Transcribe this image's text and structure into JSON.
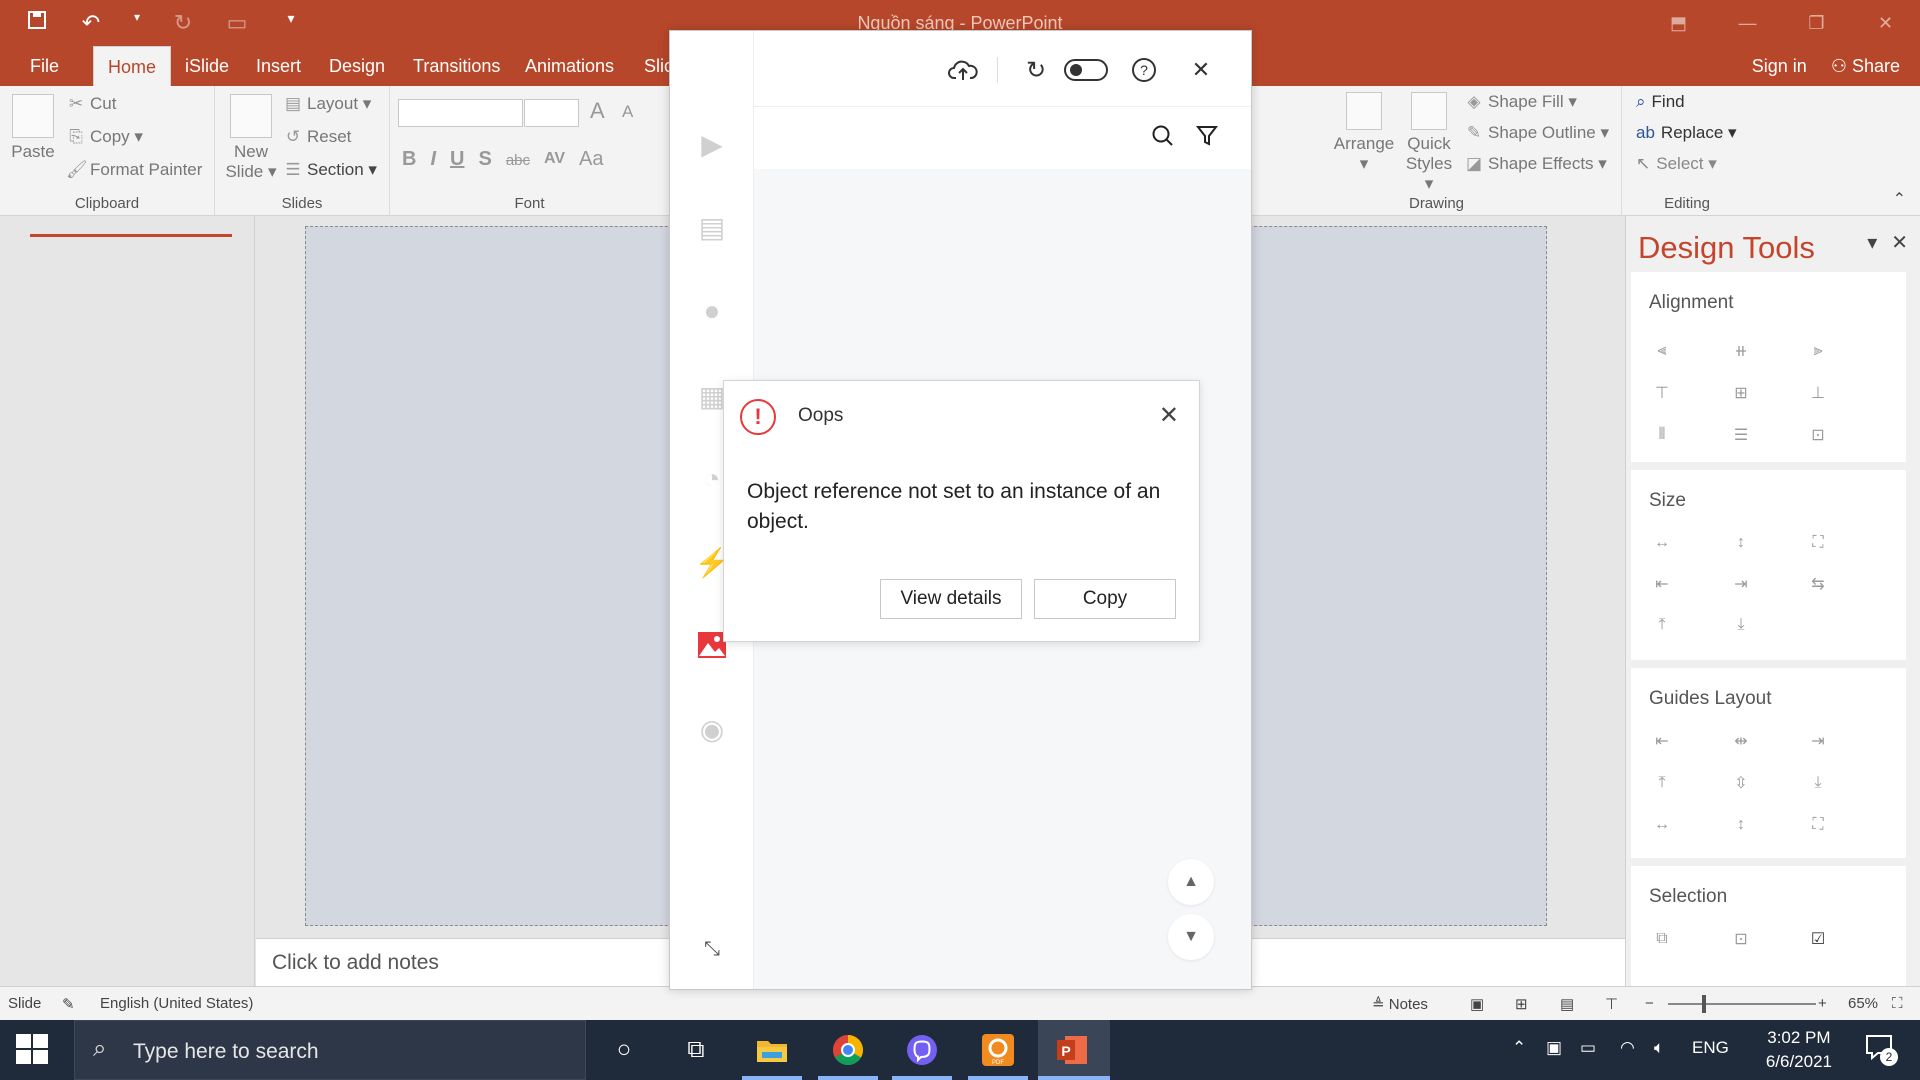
{
  "window": {
    "title": "Nguồn sáng - PowerPoint",
    "minimize_glyph": "—",
    "restore_glyph": "❐",
    "close_glyph": "✕",
    "ribbon_display_glyph": "⬒"
  },
  "qat": {
    "save_icon": "save-icon",
    "undo_icon": "undo-icon",
    "redo_icon": "redo-icon",
    "present_icon": "present-icon",
    "customize_icon": "customize-qat-icon"
  },
  "tabs": [
    "File",
    "Home",
    "iSlide",
    "Insert",
    "Design",
    "Transitions",
    "Animations",
    "Slic"
  ],
  "account": {
    "sign_in": "Sign in",
    "share": "Share"
  },
  "ribbon": {
    "clipboard": {
      "paste": "Paste",
      "cut": "Cut",
      "copy": "Copy",
      "format_painter": "Format Painter",
      "label": "Clipboard"
    },
    "slides": {
      "new_slide_1": "New",
      "new_slide_2": "Slide",
      "layout": "Layout",
      "reset": "Reset",
      "section": "Section",
      "label": "Slides"
    },
    "font": {
      "bold": "B",
      "italic": "I",
      "underline": "U",
      "shadow": "S",
      "strike": "abc",
      "spacing": "AV",
      "case": "Aa",
      "grow": "A",
      "shrink": "A",
      "label": "Font"
    },
    "drawing": {
      "arrange": "Arrange",
      "quick_styles_1": "Quick",
      "quick_styles_2": "Styles",
      "shape_fill": "Shape Fill",
      "shape_outline": "Shape Outline",
      "shape_effects": "Shape Effects",
      "label": "Drawing"
    },
    "editing": {
      "find": "Find",
      "replace": "Replace",
      "select": "Select",
      "label": "Editing"
    }
  },
  "notes_placeholder": "Click to add notes",
  "design_tools": {
    "title": "Design Tools",
    "sections": [
      "Alignment",
      "Size",
      "Guides Layout",
      "Selection"
    ]
  },
  "statusbar": {
    "slide": "Slide",
    "language": "English (United States)",
    "notes": "Notes",
    "zoom": "65%"
  },
  "taskbar": {
    "search_placeholder": "Type here to search",
    "time": "3:02 PM",
    "date": "6/6/2021",
    "language": "ENG",
    "notifications": "2"
  },
  "panel": {
    "side_icons": [
      "presentation-icon",
      "layout-icon",
      "palette-icon",
      "calendar-icon",
      "chart-icon",
      "lightning-icon",
      "picture-icon",
      "brush-icon"
    ]
  },
  "dialog": {
    "title": "Oops",
    "icon_glyph": "!",
    "message": "Object reference not set to an instance of an object.",
    "view_details": "View details",
    "copy": "Copy"
  },
  "colors": {
    "accent": "#b7472a",
    "error": "#e8383d",
    "design_tools_title": "#c4452c"
  }
}
